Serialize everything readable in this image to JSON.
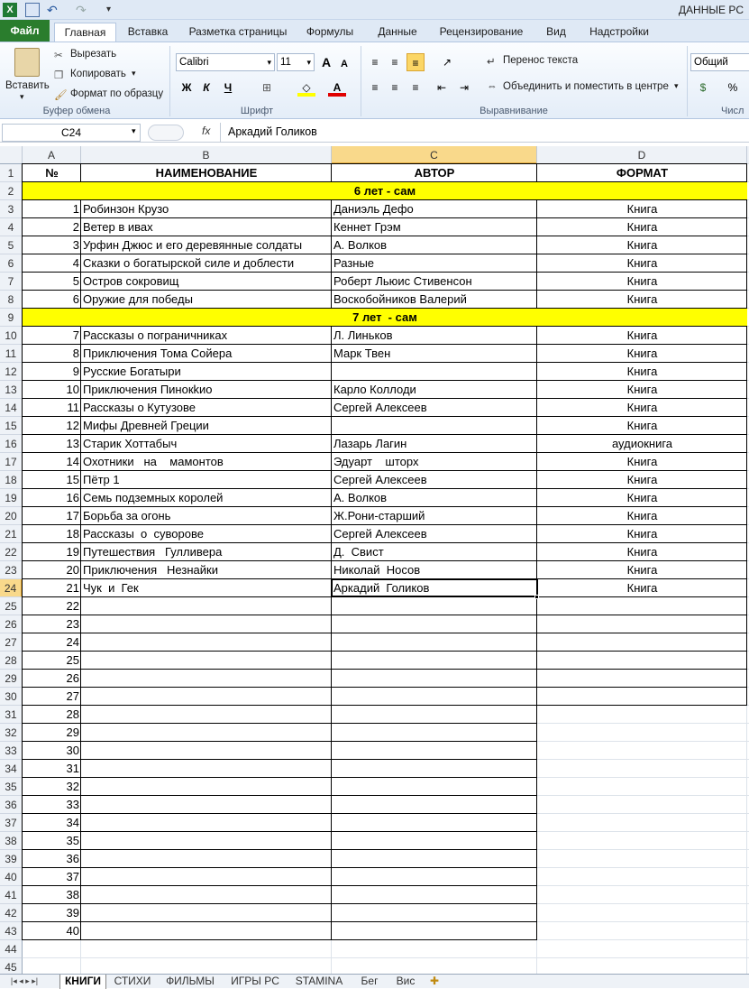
{
  "window": {
    "title": "ДАННЫЕ PC"
  },
  "tabs": [
    "Файл",
    "Главная",
    "Вставка",
    "Разметка страницы",
    "Формулы",
    "Данные",
    "Рецензирование",
    "Вид",
    "Надстройки"
  ],
  "ribbon": {
    "clipboard": {
      "paste": "Вставить",
      "cut": "Вырезать",
      "copy": "Копировать",
      "format_painter": "Формат по образцу",
      "label": "Буфер обмена"
    },
    "font": {
      "name": "Calibri",
      "size": "11",
      "bold": "Ж",
      "italic": "К",
      "underline": "Ч",
      "label": "Шрифт"
    },
    "alignment": {
      "wrap": "Перенос текста",
      "merge": "Объединить и поместить в центре",
      "label": "Выравнивание"
    },
    "number": {
      "format": "Общий",
      "percent": "%",
      "label": "Числ"
    }
  },
  "formula_bar": {
    "name_box": "C24",
    "fx": "fx",
    "value": "Аркадий  Голиков"
  },
  "columns": {
    "A": "A",
    "B": "B",
    "C": "C",
    "D": "D"
  },
  "header": {
    "no": "№",
    "name": "НАИМЕНОВАНИЕ",
    "author": "АВТОР",
    "format": "ФОРМАТ"
  },
  "bands": {
    "b6": "6 лет - сам",
    "b7": "7 лет  - сам"
  },
  "rows": [
    {
      "r": "3",
      "n": "1",
      "name": "Робинзон Крузо",
      "author": "Даниэль Дефо",
      "fmt": "Книга"
    },
    {
      "r": "4",
      "n": "2",
      "name": "Ветер в ивах",
      "author": "Кеннет Грэм",
      "fmt": "Книга"
    },
    {
      "r": "5",
      "n": "3",
      "name": "Урфин Джюс и его деревянные солдаты",
      "author": "А. Волков",
      "fmt": "Книга"
    },
    {
      "r": "6",
      "n": "4",
      "name": "Сказки о богатырской силе и доблести",
      "author": "Разные",
      "fmt": "Книга"
    },
    {
      "r": "7",
      "n": "5",
      "name": "Остров сокровищ",
      "author": "Роберт Льюис Стивенсон",
      "fmt": "Книга"
    },
    {
      "r": "8",
      "n": "6",
      "name": "Оружие для победы",
      "author": "Воскобойников Валерий",
      "fmt": "Книга"
    },
    {
      "r": "10",
      "n": "7",
      "name": "Рассказы о пограничниках",
      "author": "Л. Линьков",
      "fmt": "Книга"
    },
    {
      "r": "11",
      "n": "8",
      "name": "Приключения Тома Сойера",
      "author": "Марк Твен",
      "fmt": "Книга"
    },
    {
      "r": "12",
      "n": "9",
      "name": "Русские Богатыри",
      "author": "",
      "fmt": "Книга"
    },
    {
      "r": "13",
      "n": "10",
      "name": "Приключения Пинокkио",
      "author": "Карло Коллоди",
      "fmt": "Книга"
    },
    {
      "r": "14",
      "n": "11",
      "name": "Рассказы о Кутузове",
      "author": "Сергей Алексеев",
      "fmt": "Книга"
    },
    {
      "r": "15",
      "n": "12",
      "name": "Мифы Древней Греции",
      "author": "",
      "fmt": "Книга"
    },
    {
      "r": "16",
      "n": "13",
      "name": "Старик Хоттабыч",
      "author": "Лазарь Лагин",
      "fmt": "аудиокнига"
    },
    {
      "r": "17",
      "n": "14",
      "name": "Охотники   на    мамонтов",
      "author": "Эдуарт    шторх",
      "fmt": "Книга"
    },
    {
      "r": "18",
      "n": "15",
      "name": "Пётр 1",
      "author": "Сергей Алексеев",
      "fmt": "Книга"
    },
    {
      "r": "19",
      "n": "16",
      "name": "Семь подземных королей",
      "author": "А. Волков",
      "fmt": "Книга"
    },
    {
      "r": "20",
      "n": "17",
      "name": "Борьба за огонь",
      "author": "Ж.Рони-старший",
      "fmt": "Книга"
    },
    {
      "r": "21",
      "n": "18",
      "name": "Рассказы  о  суворове",
      "author": "Сергей Алексеев",
      "fmt": "Книга"
    },
    {
      "r": "22",
      "n": "19",
      "name": "Путешествия   Гулливера",
      "author": "Д.  Свист",
      "fmt": "Книга"
    },
    {
      "r": "23",
      "n": "20",
      "name": "Приключения   Незнайки",
      "author": "Николай  Носов",
      "fmt": "Книга"
    },
    {
      "r": "24",
      "n": "21",
      "name": "Чук  и  Гек",
      "author": "Аркадий  Голиков",
      "fmt": "Книга"
    }
  ],
  "empty_rows": [
    {
      "r": "25",
      "n": "22"
    },
    {
      "r": "26",
      "n": "23"
    },
    {
      "r": "27",
      "n": "24"
    },
    {
      "r": "28",
      "n": "25"
    },
    {
      "r": "29",
      "n": "26"
    },
    {
      "r": "30",
      "n": "27"
    },
    {
      "r": "31",
      "n": "28"
    },
    {
      "r": "32",
      "n": "29"
    },
    {
      "r": "33",
      "n": "30"
    },
    {
      "r": "34",
      "n": "31"
    },
    {
      "r": "35",
      "n": "32"
    },
    {
      "r": "36",
      "n": "33"
    },
    {
      "r": "37",
      "n": "34"
    },
    {
      "r": "38",
      "n": "35"
    },
    {
      "r": "39",
      "n": "36"
    },
    {
      "r": "40",
      "n": "37"
    },
    {
      "r": "41",
      "n": "38"
    },
    {
      "r": "42",
      "n": "39"
    },
    {
      "r": "43",
      "n": "40"
    },
    {
      "r": "44",
      "n": ""
    },
    {
      "r": "45",
      "n": ""
    }
  ],
  "row_labels": {
    "r1": "1",
    "r2": "2",
    "r9": "9"
  },
  "sheets": [
    "КНИГИ",
    "СТИХИ",
    "ФИЛЬМЫ",
    "ИГРЫ PC",
    "STAMINA",
    "Бег",
    "Вис"
  ],
  "colors": {
    "band": "#ffff00",
    "selected_header": "#f9d98b",
    "file_tab": "#2a7d2d"
  }
}
